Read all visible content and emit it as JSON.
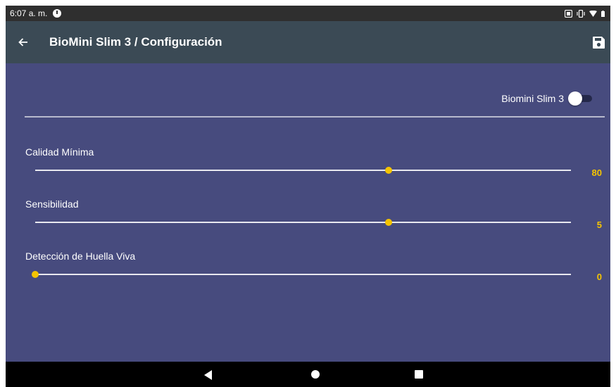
{
  "status_bar": {
    "time": "6:07 a. m.",
    "icons": [
      "clock-icon",
      "screenshot-icon",
      "vibrate-icon",
      "wifi-icon",
      "battery-icon"
    ]
  },
  "app_bar": {
    "back_icon": "arrow-left-icon",
    "title": "BioMini Slim 3 / Configuración",
    "save_icon": "save-icon"
  },
  "device_toggle": {
    "label": "Biomini Slim 3",
    "enabled": false
  },
  "settings": [
    {
      "label": "Calidad Mínima",
      "value": "80",
      "level": 0.66
    },
    {
      "label": "Sensibilidad",
      "value": "5",
      "level": 0.66
    },
    {
      "label": "Detección de Huella Viva",
      "value": "0",
      "level": 0.0
    }
  ],
  "nav_bar": {
    "icons": [
      "nav-back-icon",
      "nav-home-icon",
      "nav-recents-icon"
    ]
  },
  "colors": {
    "status_bar": "#2f2f2f",
    "app_bar": "#3b4a55",
    "content_background": "#474b7e",
    "accent": "#f5c400",
    "nav_bar": "#000000"
  }
}
